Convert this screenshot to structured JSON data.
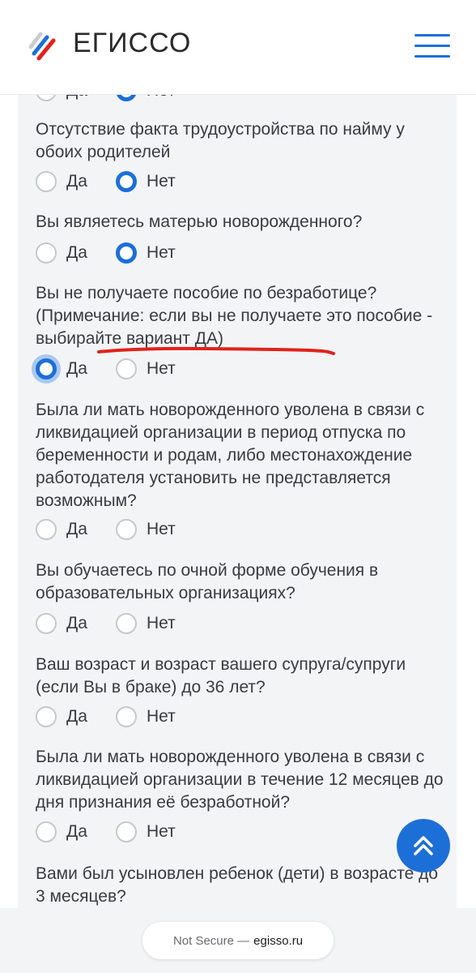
{
  "header": {
    "logo_text": "ЕГИССО",
    "logo_icon": "russian-flag-stripes-icon",
    "menu_icon": "hamburger-menu-icon"
  },
  "options": {
    "yes": "Да",
    "no": "Нет"
  },
  "questions": [
    {
      "text": "Отсутствие факта трудоустройства по найму у обоих родителей",
      "selected": "no"
    },
    {
      "text": "Вы являетесь матерью новорожденного?",
      "selected": "no"
    },
    {
      "text": "Вы не получаете пособие по безработице? (Примечание: если вы не получаете это пособие - выбирайте вариант ДА)",
      "selected": "yes"
    },
    {
      "text": "Была ли мать новорожденного уволена в связи с ликвидацией организации в период отпуска по беременности и родам, либо местонахождение работодателя установить не представляется возможным?",
      "selected": null
    },
    {
      "text": "Вы обучаетесь по очной форме обучения в образовательных организациях?",
      "selected": null
    },
    {
      "text": "Ваш возраст и возраст вашего супруга/супруги (если Вы в браке) до 36 лет?",
      "selected": null
    },
    {
      "text": "Была ли мать новорожденного уволена в связи с ликвидацией организации в течение 12 месяцев до дня признания её безработной?",
      "selected": null
    },
    {
      "text": "Вами был усыновлен ребенок (дети) в возрасте до 3 месяцев?",
      "selected": null
    }
  ],
  "scroll_top_icon": "double-chevron-up-icon",
  "browser": {
    "security": "Not Secure —",
    "domain": "egisso.ru"
  },
  "colors": {
    "accent": "#1d6fd8",
    "annotation": "#e0231b",
    "panel_bg": "#f3f4f6",
    "text": "#3a3b40"
  }
}
